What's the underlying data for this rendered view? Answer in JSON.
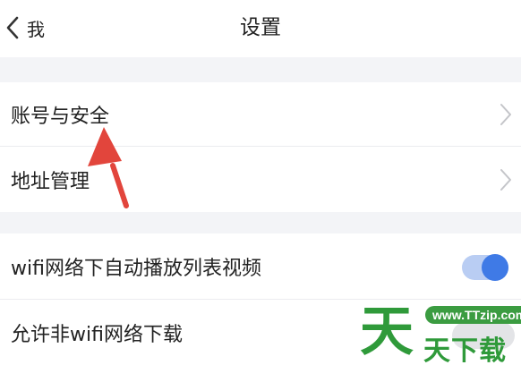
{
  "header": {
    "back_label": "我",
    "title": "设置"
  },
  "rows": [
    {
      "label": "账号与安全",
      "trailing": "chevron-right-icon"
    },
    {
      "label": "地址管理",
      "trailing": "chevron-right-icon"
    },
    {
      "label": "wifi网络下自动播放列表视频",
      "trailing": "toggle",
      "toggle_on": true
    },
    {
      "label": "允许非wifi网络下载",
      "trailing": "toggle",
      "toggle_on": false
    }
  ],
  "watermark": {
    "logo_char": "天",
    "url": "www.TTzip.com",
    "name": "天下载"
  },
  "colors": {
    "accent": "#3f7ae6",
    "accent_track": "#b9cdf3",
    "section_gap": "#f3f4f7",
    "annotation_arrow": "#e2453c",
    "watermark_green": "#2f9a3a"
  }
}
